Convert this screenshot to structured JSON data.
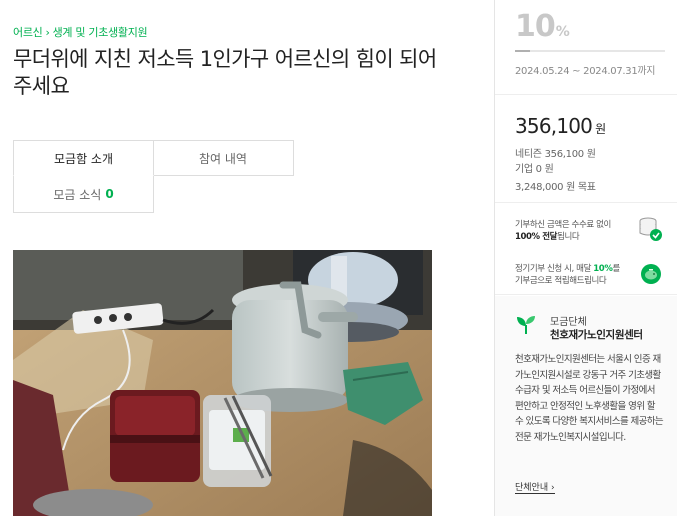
{
  "breadcrumb": {
    "category": "어르신",
    "separator": "›",
    "subcategory": "생계 및 기초생활지원"
  },
  "page_title": "무더위에 지친 저소득 1인가구 어르신의 힘이 되어주세요",
  "tabs": [
    {
      "label": "모금함 소개",
      "active": true
    },
    {
      "label": "참여 내역",
      "active": false
    },
    {
      "label": "모금 소식",
      "count": "0",
      "active": false
    }
  ],
  "progress": {
    "percent": "10",
    "unit": "%",
    "fraction": 0.1
  },
  "period": {
    "start": "2024.05.24",
    "separator": "~",
    "end": "2024.07.31",
    "suffix": "까지"
  },
  "amount": {
    "value": "356,100",
    "unit": "원"
  },
  "breakdown": {
    "netizen": "네티즌 356,100 원",
    "company": "기업 0 원",
    "goal": "3,248,000 원 목표"
  },
  "notice1": {
    "line1": "기부하신 금액은 수수료 없이",
    "line2_strong": "100% 전달",
    "line2_rest": "됩니다"
  },
  "notice2": {
    "line1_pre": "정기기부 신청 시, 매달 ",
    "line1_strong": "10%",
    "line1_post": "를",
    "line2": "기부금으로 적립해드립니다"
  },
  "org": {
    "label": "모금단체",
    "name": "천호재가노인지원센터",
    "description": "천호재가노인지원센터는 서울시 인증 재가노인지원시설로 강동구 거주 기초생활수급자 및 저소득 어르신들이 가정에서 편안하고 안정적인 노후생활을 영위 할 수 있도록 다양한 복지서비스를 제공하는 전문 재가노인복지시설입니다.",
    "link": "단체안내",
    "link_arrow": "›"
  },
  "colors": {
    "accent": "#00b050",
    "percent_gray": "#c8c8c8"
  },
  "icons": {
    "coins": "coins-icon",
    "piggy": "piggy-icon",
    "leaf": "leaf-icon"
  }
}
